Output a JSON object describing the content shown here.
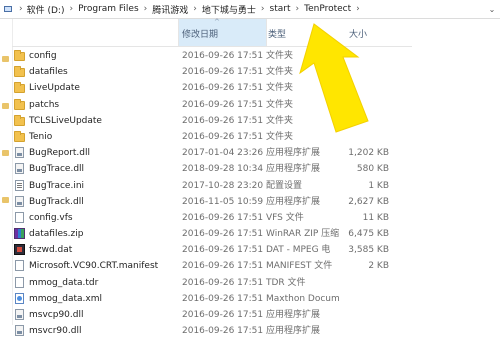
{
  "breadcrumb": [
    "软件 (D:)",
    "Program Files",
    "腾讯游戏",
    "地下城与勇士",
    "start",
    "TenProtect"
  ],
  "header": {
    "date": "修改日期",
    "type": "类型",
    "size": "大小"
  },
  "files": [
    {
      "name": "config",
      "date": "2016-09-26 17:51",
      "type": "文件夹",
      "size": "",
      "icon": "folder-icon"
    },
    {
      "name": "datafiles",
      "date": "2016-09-26 17:51",
      "type": "文件夹",
      "size": "",
      "icon": "folder-icon"
    },
    {
      "name": "LiveUpdate",
      "date": "2016-09-26 17:51",
      "type": "文件夹",
      "size": "",
      "icon": "folder-icon"
    },
    {
      "name": "patchs",
      "date": "2016-09-26 17:51",
      "type": "文件夹",
      "size": "",
      "icon": "folder-icon"
    },
    {
      "name": "TCLSLiveUpdate",
      "date": "2016-09-26 17:51",
      "type": "文件夹",
      "size": "",
      "icon": "folder-icon"
    },
    {
      "name": "Tenio",
      "date": "2016-09-26 17:51",
      "type": "文件夹",
      "size": "",
      "icon": "folder-icon"
    },
    {
      "name": "BugReport.dll",
      "date": "2017-01-04 23:26",
      "type": "应用程序扩展",
      "size": "1,202 KB",
      "icon": "dll-icon"
    },
    {
      "name": "BugTrace.dll",
      "date": "2018-09-28 10:34",
      "type": "应用程序扩展",
      "size": "580 KB",
      "icon": "dll-icon"
    },
    {
      "name": "BugTrace.ini",
      "date": "2017-10-28 23:20",
      "type": "配置设置",
      "size": "1 KB",
      "icon": "ini-icon"
    },
    {
      "name": "BugTrack.dll",
      "date": "2016-11-05 10:59",
      "type": "应用程序扩展",
      "size": "2,627 KB",
      "icon": "dll-icon"
    },
    {
      "name": "config.vfs",
      "date": "2016-09-26 17:51",
      "type": "VFS 文件",
      "size": "11 KB",
      "icon": "file-icon"
    },
    {
      "name": "datafiles.zip",
      "date": "2016-09-26 17:51",
      "type": "WinRAR ZIP 压缩",
      "size": "6,475 KB",
      "icon": "zip-icon"
    },
    {
      "name": "fszwd.dat",
      "date": "2016-09-26 17:51",
      "type": "DAT - MPEG 电",
      "size": "3,585 KB",
      "icon": "dat-icon"
    },
    {
      "name": "Microsoft.VC90.CRT.manifest",
      "date": "2016-09-26 17:51",
      "type": "MANIFEST 文件",
      "size": "2 KB",
      "icon": "file-icon"
    },
    {
      "name": "mmog_data.tdr",
      "date": "2016-09-26 17:51",
      "type": "TDR 文件",
      "size": "",
      "icon": "file-icon"
    },
    {
      "name": "mmog_data.xml",
      "date": "2016-09-26 17:51",
      "type": "Maxthon Docum",
      "size": "",
      "icon": "web-icon"
    },
    {
      "name": "msvcp90.dll",
      "date": "2016-09-26 17:51",
      "type": "应用程序扩展",
      "size": "",
      "icon": "dll-icon"
    },
    {
      "name": "msvcr90.dll",
      "date": "2016-09-26 17:51",
      "type": "应用程序扩展",
      "size": "",
      "icon": "dll-icon"
    }
  ],
  "annotation": {
    "arrow_color": "#ffe600"
  }
}
